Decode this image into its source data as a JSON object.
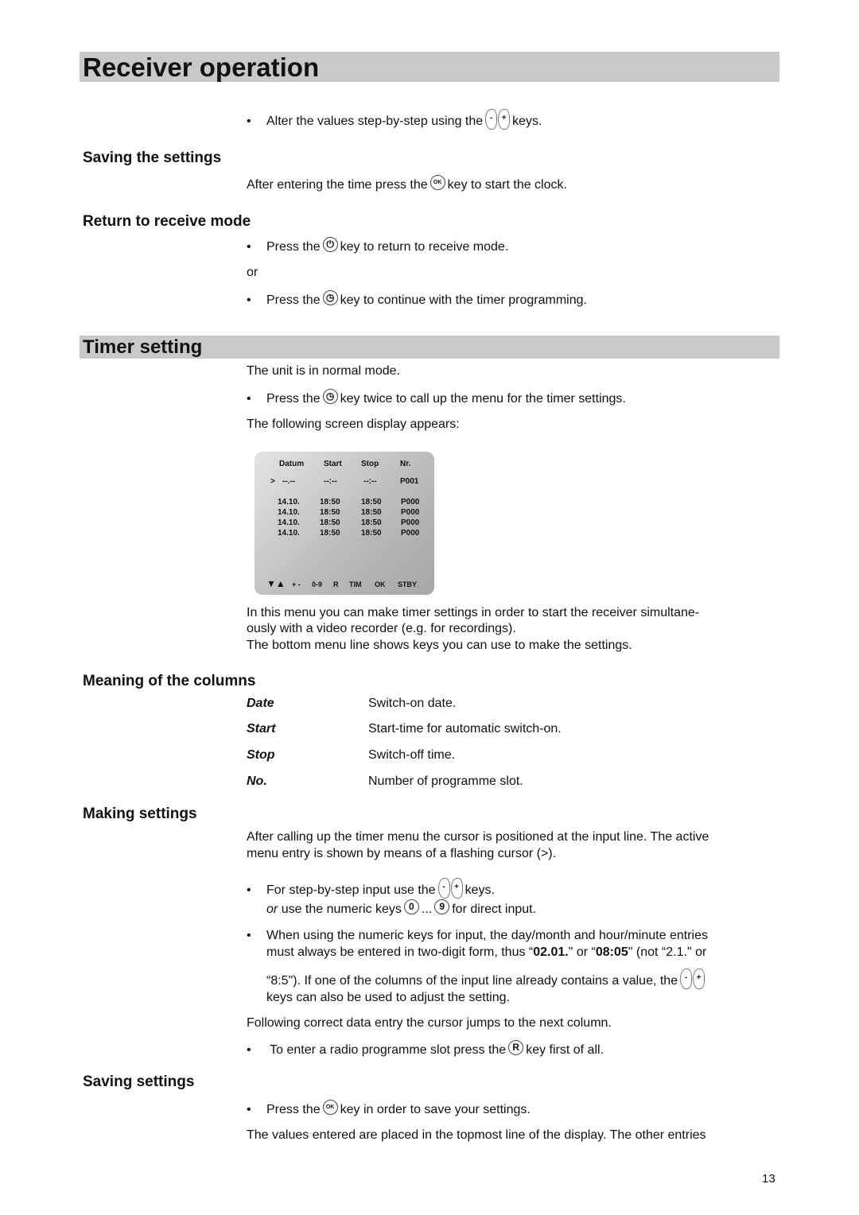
{
  "title": "Receiver operation",
  "intro": {
    "before": "Alter the values step-by-step using the",
    "after": "keys."
  },
  "saving_the_settings": {
    "heading": "Saving the settings",
    "before": "After entering the time press the",
    "after": "key to start the clock."
  },
  "return": {
    "heading": "Return to receive mode",
    "b1_before": "Press the",
    "b1_after": "key to return to receive mode.",
    "or": "or",
    "b2_before": "Press the",
    "b2_after": "key to continue with the timer programming."
  },
  "timer": {
    "heading": "Timer setting",
    "p1": "The unit is in normal mode.",
    "b1_before": "Press the",
    "b1_after": "key twice to call up the menu for the timer settings.",
    "p2": "The following screen display appears:",
    "screen": {
      "headers": [
        "Datum",
        "Start",
        "Stop",
        "Nr."
      ],
      "cursor": ">",
      "input_row": [
        "--.--",
        "--:--",
        "--:--",
        "P001"
      ],
      "rows": [
        [
          "14.10.",
          "18:50",
          "18:50",
          "P000"
        ],
        [
          "14.10.",
          "18:50",
          "18:50",
          "P000"
        ],
        [
          "14.10.",
          "18:50",
          "18:50",
          "P000"
        ],
        [
          "14.10.",
          "18:50",
          "18:50",
          "P000"
        ]
      ],
      "menu": [
        "▼▲",
        "+ -",
        "0-9",
        "R",
        "TIM",
        "OK",
        "STBY"
      ]
    },
    "p3a": "In this menu you can make timer settings in order to start the receiver simultane-",
    "p3b": "ously with a video recorder (e.g. for recordings).",
    "p3c": "The bottom menu line shows keys you can use to make the settings."
  },
  "columns": {
    "heading": "Meaning of the columns",
    "items": [
      {
        "term": "Date",
        "desc": "Switch-on date."
      },
      {
        "term": "Start",
        "desc": "Start-time for automatic switch-on."
      },
      {
        "term": "Stop",
        "desc": "Switch-off time."
      },
      {
        "term": "No.",
        "desc": "Number of programme slot."
      }
    ]
  },
  "making": {
    "heading": "Making settings",
    "p1a": "After calling up the timer menu the cursor is positioned at the input line. The active",
    "p1b": "menu entry is shown by means of a flashing cursor (>).",
    "b1_before": "For step-by-step input use the",
    "b1_after": "keys.",
    "b1_or": "or",
    "b1_num": "use the numeric keys",
    "b1_dots": "...",
    "b1_end": "for direct input.",
    "b2a": "When using the numeric keys for input, the day/month and hour/minute entries",
    "b2b_1": "must always be entered in two-digit form, thus “",
    "b2b_2": "02.01.",
    "b2b_3": "\" or “",
    "b2b_4": "08:05",
    "b2b_5": "\" (not “2.1.\" or",
    "b2c": "“8:5\"). If one of the columns of the input line already contains a value, the",
    "b2d": "keys can also be used to adjust the setting.",
    "p2": "Following correct data entry the cursor jumps to the next column.",
    "b3_before": " To enter a radio programme slot press the",
    "b3_after": "key first of all."
  },
  "saving": {
    "heading": "Saving settings",
    "b1_before": "Press the",
    "b1_after": "key in order to save your settings.",
    "p1": "The values entered are placed in the topmost line of the display. The other entries"
  },
  "keys": {
    "minus": "-",
    "plus": "+",
    "ok": "OK",
    "zero": "0",
    "nine": "9",
    "r": "R"
  },
  "page_number": "13",
  "bullet": "•"
}
